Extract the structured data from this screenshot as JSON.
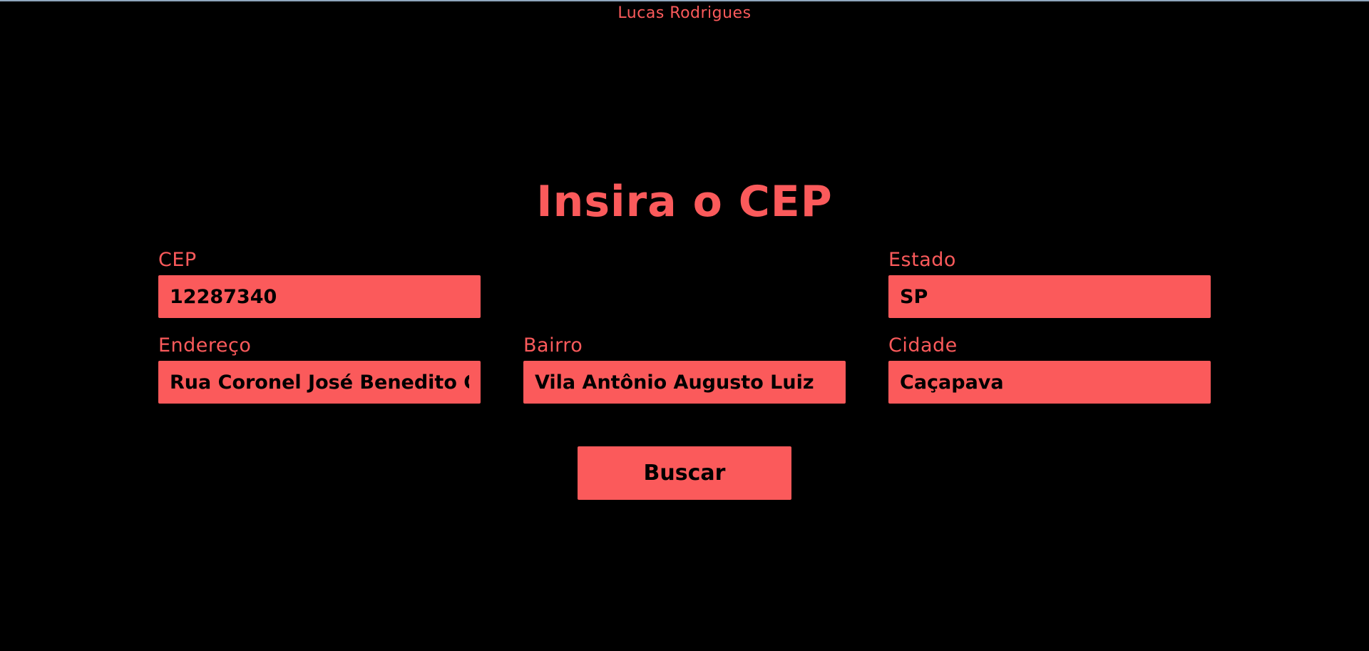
{
  "header": {
    "author": "Lucas Rodrigues"
  },
  "form": {
    "title": "Insira o CEP",
    "cep": {
      "label": "CEP",
      "value": "12287340"
    },
    "estado": {
      "label": "Estado",
      "value": "SP"
    },
    "endereco": {
      "label": "Endereço",
      "value": "Rua Coronel José Benedito Carvalho"
    },
    "bairro": {
      "label": "Bairro",
      "value": "Vila Antônio Augusto Luiz"
    },
    "cidade": {
      "label": "Cidade",
      "value": "Caçapava"
    },
    "search_label": "Buscar"
  },
  "colors": {
    "background": "#000000",
    "accent": "#fb5a5b",
    "text_on_accent": "#000000"
  }
}
